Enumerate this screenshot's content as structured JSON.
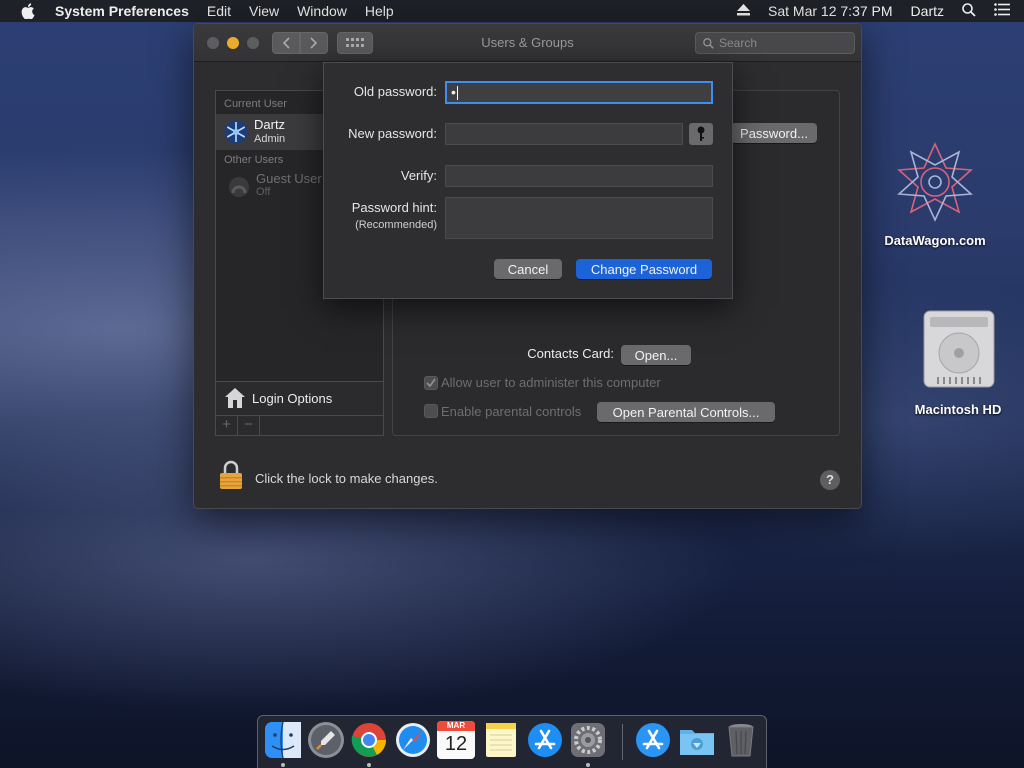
{
  "menubar": {
    "app_name": "System Preferences",
    "items": [
      "Edit",
      "View",
      "Window",
      "Help"
    ],
    "datetime": "Sat Mar 12  7:37 PM",
    "user": "Dartz"
  },
  "window": {
    "title": "Users & Groups",
    "search_placeholder": "Search"
  },
  "sidebar": {
    "current_user_header": "Current User",
    "current_user": {
      "name": "Dartz",
      "role": "Admin"
    },
    "other_users_header": "Other Users",
    "other_user": {
      "name": "Guest User",
      "status": "Off"
    },
    "login_options": "Login Options",
    "add_label": "+",
    "remove_label": "−"
  },
  "content": {
    "change_password_button": "Password...",
    "contacts_card_label": "Contacts Card:",
    "open_button": "Open...",
    "allow_admin_label": "Allow user to administer this computer",
    "allow_admin_checked": true,
    "parental_controls_label": "Enable parental controls",
    "parental_controls_checked": false,
    "open_parental_button": "Open Parental Controls..."
  },
  "footer": {
    "lock_text": "Click the lock to make changes.",
    "help_label": "?"
  },
  "sheet": {
    "old_password_label": "Old password:",
    "old_password_value": "•",
    "new_password_label": "New password:",
    "verify_label": "Verify:",
    "hint_label": "Password hint:",
    "hint_sublabel": "(Recommended)",
    "cancel_button": "Cancel",
    "change_button": "Change Password"
  },
  "desktop": {
    "icons": [
      {
        "label": "DataWagon.com"
      },
      {
        "label": "Macintosh HD"
      }
    ]
  },
  "dock": {
    "calendar_month": "MAR",
    "calendar_day": "12",
    "apps": [
      "Finder",
      "Launchpad",
      "Chrome",
      "Safari",
      "Calendar",
      "Notes",
      "App Store",
      "System Preferences",
      "App Store",
      "Downloads",
      "Trash"
    ]
  },
  "colors": {
    "accent": "#1b63d6",
    "focus_ring": "#3d8ef0",
    "lock": "#e8a33a"
  }
}
